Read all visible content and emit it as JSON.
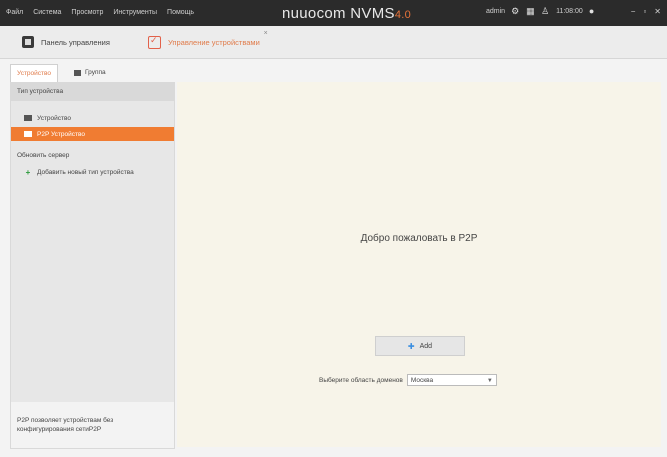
{
  "topbar": {
    "menu": [
      "Файл",
      "Система",
      "Просмотр",
      "Инструменты",
      "Помощь"
    ],
    "brand": "nuuocom NVMS",
    "version": "4.0",
    "user": "admin",
    "time": "11:08:00",
    "icons": [
      "gear-icon",
      "grid-icon",
      "person-icon",
      "bell-icon"
    ],
    "window_buttons": [
      "−",
      "▫",
      "✕"
    ]
  },
  "tabs": {
    "home": "Панель управления",
    "devices": "Управление устройствами"
  },
  "subtabs": {
    "active": "Устройство",
    "other": "Группа"
  },
  "sidebar": {
    "header": "Тип устройства",
    "items": [
      {
        "label": "Устройство",
        "icon": "device-icon"
      },
      {
        "label": "P2P Устройство",
        "icon": "device-icon",
        "selected": true
      },
      {
        "label": "Обновить сервер"
      },
      {
        "label": "Добавить новый тип устройства",
        "icon": "plus-icon"
      }
    ],
    "footer": "P2P позволяет устройствам без конфигурирования сетиP2P"
  },
  "main": {
    "welcome": "Добро пожаловать в P2P",
    "add_button": "Add",
    "lang_label": "Выберите область доменов",
    "lang_value": "Москва"
  },
  "colors": {
    "accent": "#f07c32",
    "topbar": "#2b2b2b",
    "main_bg": "#f7f4e9"
  }
}
